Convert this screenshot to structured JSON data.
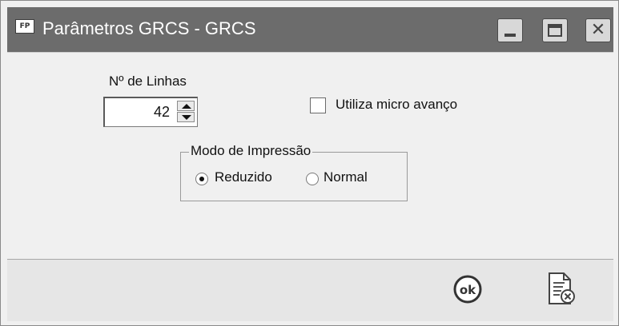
{
  "window": {
    "title": "Parâmetros GRCS - GRCS",
    "app_icon_text": "FP",
    "buttons": {
      "minimize_icon": "minimize-icon",
      "maximize_icon": "maximize-icon",
      "close_icon": "close-icon",
      "close_glyph": "✕"
    },
    "title_bar_color": "#6c6c6c"
  },
  "form": {
    "linhas_label": "Nº de Linhas",
    "linhas_value": "42",
    "micro_avanco_label": "Utiliza micro avanço",
    "micro_avanco_checked": false,
    "modo_group_label": "Modo de Impressão",
    "modo_options": [
      {
        "label": "Reduzido",
        "selected": true
      },
      {
        "label": "Normal",
        "selected": false
      }
    ]
  },
  "footer": {
    "ok_icon": "ok-icon",
    "ok_text": "ok",
    "cancel_icon": "cancel-document-icon"
  }
}
